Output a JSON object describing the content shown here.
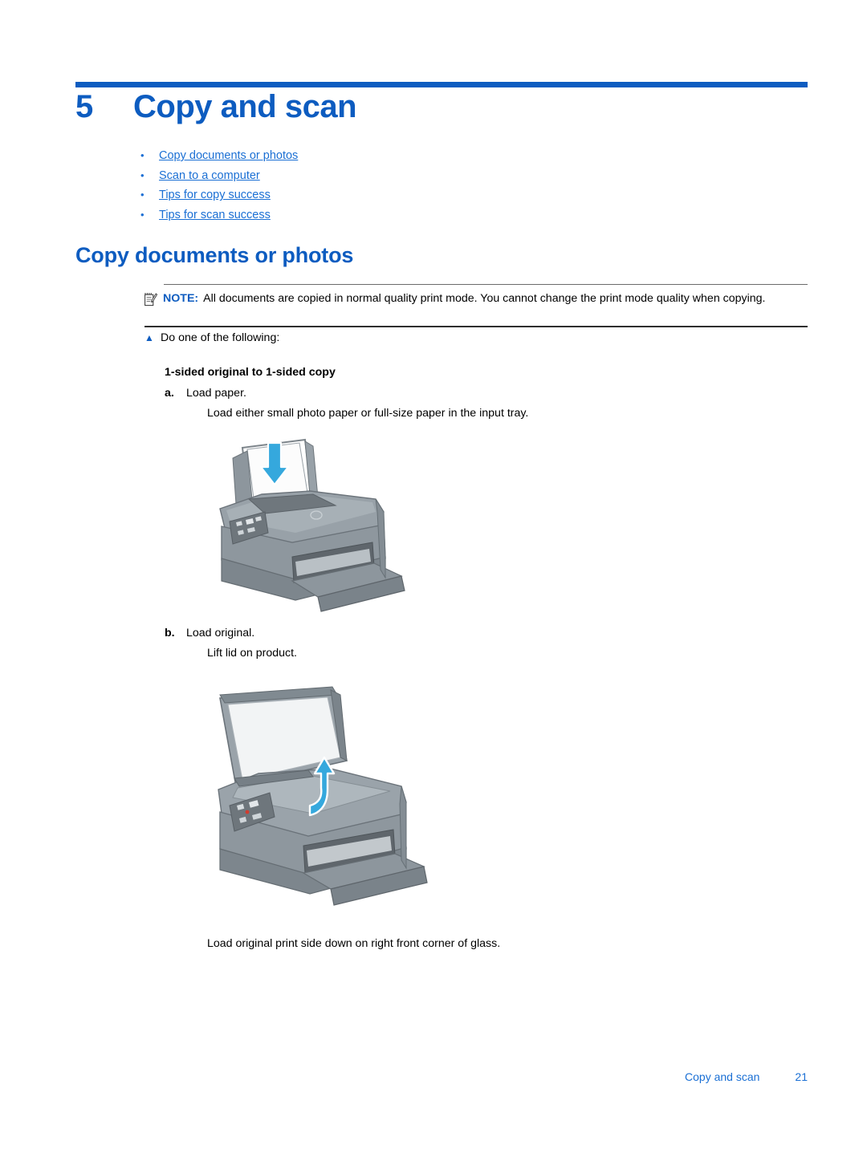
{
  "chapter": {
    "number": "5",
    "title": "Copy and scan"
  },
  "toc": {
    "bullet": "•",
    "items": [
      {
        "label": "Copy documents or photos"
      },
      {
        "label": "Scan to a computer"
      },
      {
        "label": "Tips for copy success"
      },
      {
        "label": "Tips for scan success"
      }
    ]
  },
  "section": {
    "title": "Copy documents or photos"
  },
  "note": {
    "icon": "note-pencil-icon",
    "label": "NOTE:",
    "text": "All documents are copied in normal quality print mode. You cannot change the print mode quality when copying."
  },
  "intro": {
    "bullet": "▲",
    "text": "Do one of the following:"
  },
  "procedure": {
    "title": "1-sided original to 1-sided copy",
    "steps": [
      {
        "letter": "a.",
        "text": "Load paper.",
        "detail": "Load either small photo paper or full-size paper in the input tray.",
        "figure": "printer-load-paper-illustration"
      },
      {
        "letter": "b.",
        "text": "Load original.",
        "detail": "Lift lid on product.",
        "figure": "printer-lift-lid-illustration",
        "caption": "Load original print side down on right front corner of glass."
      }
    ]
  },
  "footer": {
    "chapter_label": "Copy and scan",
    "page_number": "21"
  },
  "colors": {
    "heading_blue": "#0d5cc0",
    "link_blue": "#1a6fd4",
    "arrow_cyan": "#35a8dd",
    "rule_gray": "#6b6b6b",
    "rule_dark": "#2e2e2e"
  }
}
